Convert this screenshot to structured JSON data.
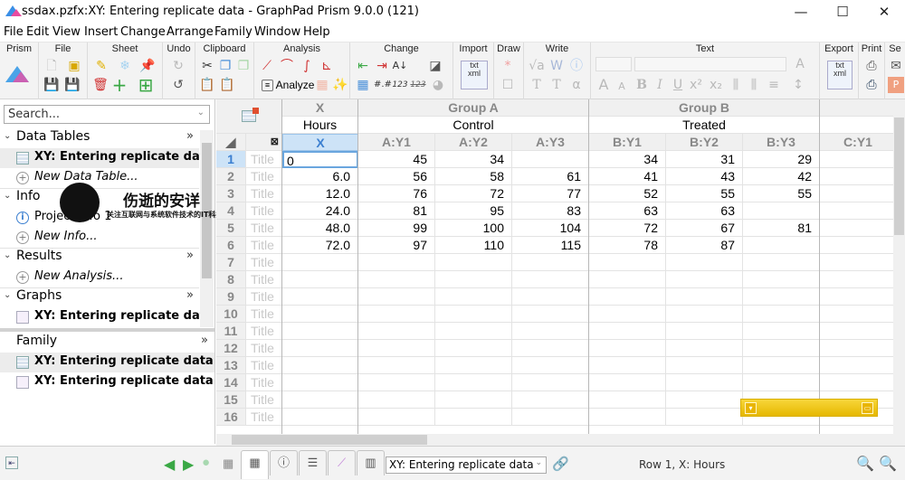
{
  "window": {
    "title": "ssdax.pzfx:XY: Entering replicate data - GraphPad Prism 9.0.0 (121)",
    "controls": {
      "minimize": "—",
      "maximize": "☐",
      "close": "✕"
    }
  },
  "menu": [
    "File",
    "Edit",
    "View",
    "Insert",
    "Change",
    "Arrange",
    "Family",
    "Window",
    "Help"
  ],
  "ribbon": {
    "groups": [
      "Prism",
      "File",
      "Sheet",
      "Undo",
      "Clipboard",
      "Analysis",
      "Change",
      "Import",
      "Draw",
      "Write",
      "Text",
      "Export",
      "Print",
      "Se"
    ],
    "analyze_label": "Analyze"
  },
  "navigator": {
    "search_placeholder": "Search...",
    "sections": {
      "data_tables": {
        "label": "Data Tables",
        "items": [
          "XY: Entering replicate data"
        ],
        "new": "New Data Table..."
      },
      "info": {
        "label": "Info",
        "items": [
          "Project info 1"
        ],
        "new": "New Info..."
      },
      "results": {
        "label": "Results",
        "new": "New Analysis..."
      },
      "graphs": {
        "label": "Graphs",
        "items": [
          "XY: Entering replicate data"
        ]
      }
    },
    "family": {
      "label": "Family",
      "items": [
        "XY: Entering replicate data",
        "XY: Entering replicate data"
      ]
    },
    "more": "»"
  },
  "watermark": {
    "title": "伤逝的安详",
    "subtitle": "关注互联网与系统软件技术的IT科技博客"
  },
  "sheet": {
    "x_group": "X",
    "x_title": "Hours",
    "x_sub": "X",
    "groups": [
      {
        "name": "Group A",
        "title": "Control",
        "cols": [
          "A:Y1",
          "A:Y2",
          "A:Y3"
        ]
      },
      {
        "name": "Group B",
        "title": "Treated",
        "cols": [
          "B:Y1",
          "B:Y2",
          "B:Y3"
        ]
      },
      {
        "name": "",
        "title": "",
        "cols": [
          "C:Y1"
        ]
      }
    ],
    "row_title_placeholder": "Title",
    "row_count": 16,
    "rows": [
      {
        "x": "0",
        "a": [
          "45",
          "34",
          ""
        ],
        "b": [
          "34",
          "31",
          "29"
        ]
      },
      {
        "x": "6.0",
        "a": [
          "56",
          "58",
          "61"
        ],
        "b": [
          "41",
          "43",
          "42"
        ]
      },
      {
        "x": "12.0",
        "a": [
          "76",
          "72",
          "77"
        ],
        "b": [
          "52",
          "55",
          "55"
        ]
      },
      {
        "x": "24.0",
        "a": [
          "81",
          "95",
          "83"
        ],
        "b": [
          "63",
          "63",
          ""
        ]
      },
      {
        "x": "48.0",
        "a": [
          "99",
          "100",
          "104"
        ],
        "b": [
          "72",
          "67",
          "81"
        ]
      },
      {
        "x": "72.0",
        "a": [
          "97",
          "110",
          "115"
        ],
        "b": [
          "78",
          "87",
          ""
        ]
      }
    ],
    "active_cell": "Row 1, X"
  },
  "statusbar": {
    "sheet_select": "XY: Entering replicate data",
    "status": "Row 1, X: Hours"
  },
  "colors": {
    "accent": "#3b7fd0",
    "selection": "#cde3f7",
    "floatbar": "#f1c40f",
    "nav_green": "#3aa845"
  }
}
